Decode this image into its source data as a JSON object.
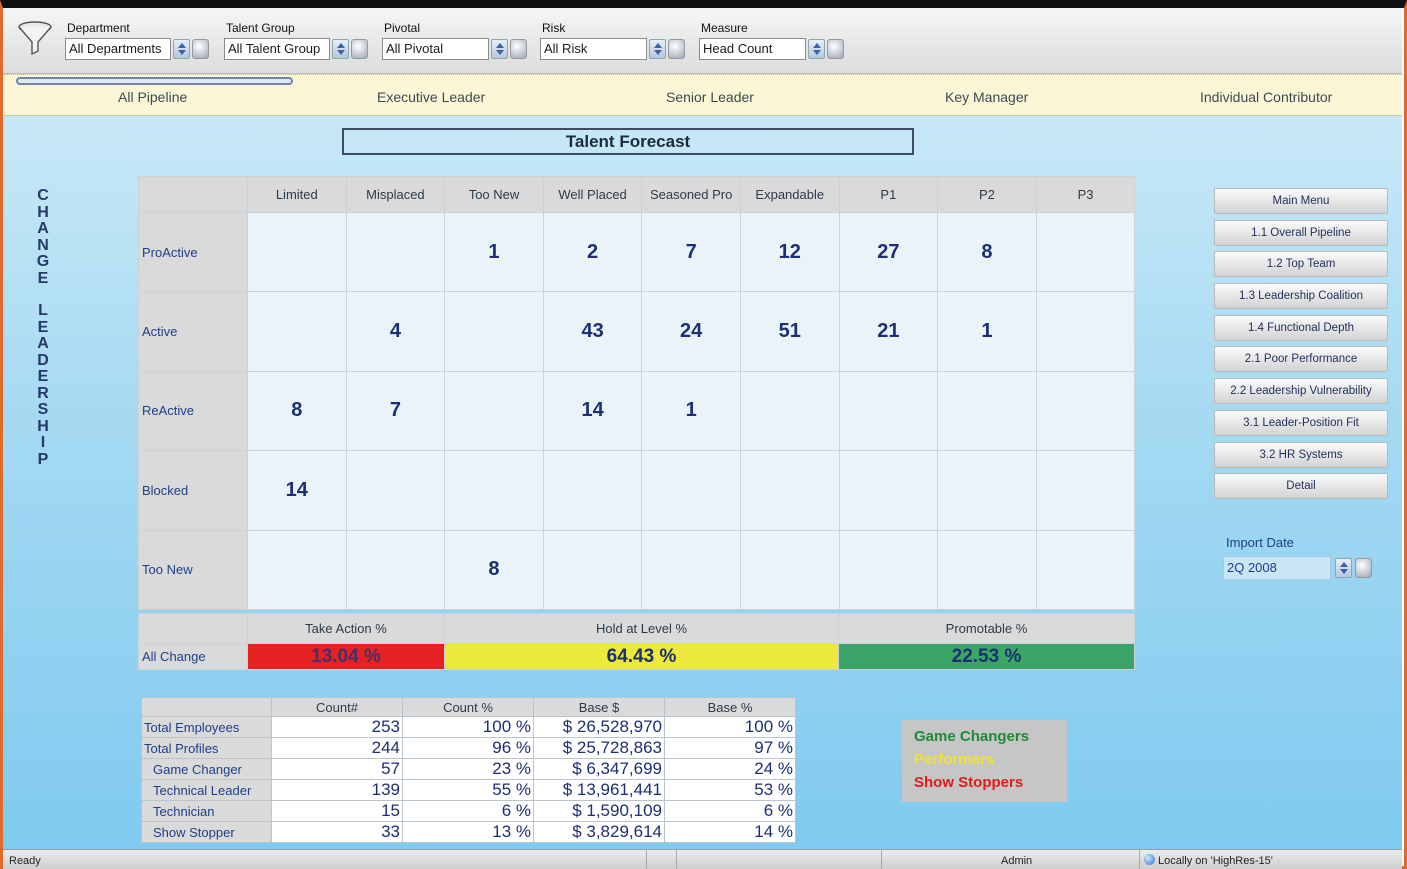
{
  "filters": [
    {
      "label": "Department",
      "value": "All Departments"
    },
    {
      "label": "Talent Group",
      "value": "All Talent Group"
    },
    {
      "label": "Pivotal",
      "value": "All Pivotal"
    },
    {
      "label": "Risk",
      "value": "All Risk"
    },
    {
      "label": "Measure",
      "value": "Head Count"
    }
  ],
  "tabs": [
    "All Pipeline",
    "Executive Leader",
    "Senior Leader",
    "Key Manager",
    "Individual Contributor"
  ],
  "title": "Talent Forecast",
  "side_label": "CHANGE LEADERSHIP",
  "matrix": {
    "columns": [
      "Limited",
      "Misplaced",
      "Too New",
      "Well Placed",
      "Seasoned Pro",
      "Expandable",
      "P1",
      "P2",
      "P3"
    ],
    "rows": [
      {
        "label": "ProActive",
        "cells": [
          "",
          "",
          "1",
          "2",
          "7",
          "12",
          "27",
          "8",
          ""
        ],
        "colors": [
          "",
          "",
          "y",
          "y",
          "y",
          "y",
          "g",
          "g",
          ""
        ]
      },
      {
        "label": "Active",
        "cells": [
          "",
          "4",
          "",
          "43",
          "24",
          "51",
          "21",
          "1",
          ""
        ],
        "colors": [
          "",
          "r",
          "",
          "y",
          "y",
          "y",
          "g",
          "g",
          ""
        ]
      },
      {
        "label": "ReActive",
        "cells": [
          "8",
          "7",
          "",
          "14",
          "1",
          "",
          "",
          "",
          ""
        ],
        "colors": [
          "r",
          "r",
          "",
          "y",
          "y",
          "",
          "",
          "",
          ""
        ]
      },
      {
        "label": "Blocked",
        "cells": [
          "14",
          "",
          "",
          "",
          "",
          "",
          "",
          "",
          ""
        ],
        "colors": [
          "r",
          "",
          "",
          "",
          "",
          "",
          "",
          "",
          ""
        ]
      },
      {
        "label": "Too New",
        "cells": [
          "",
          "",
          "8",
          "",
          "",
          "",
          "",
          "",
          ""
        ],
        "colors": [
          "",
          "",
          "y",
          "",
          "",
          "",
          "",
          "",
          ""
        ]
      }
    ]
  },
  "summary": {
    "headers": [
      "Take Action %",
      "Hold at Level %",
      "Promotable %"
    ],
    "row_label": "All Change",
    "values": [
      "13.04 %",
      "64.43 %",
      "22.53 %"
    ]
  },
  "stats": {
    "headers": [
      "Count#",
      "Count %",
      "Base $",
      "Base %"
    ],
    "rows": [
      {
        "label": "Total Employees",
        "indent": false,
        "values": [
          "253",
          "100 %",
          "$ 26,528,970",
          "100 %"
        ]
      },
      {
        "label": "Total Profiles",
        "indent": false,
        "values": [
          "244",
          "96 %",
          "$ 25,728,863",
          "97 %"
        ]
      },
      {
        "label": "Game Changer",
        "indent": true,
        "values": [
          "57",
          "23 %",
          "$ 6,347,699",
          "24 %"
        ]
      },
      {
        "label": "Technical Leader",
        "indent": true,
        "values": [
          "139",
          "55 %",
          "$ 13,961,441",
          "53 %"
        ]
      },
      {
        "label": "Technician",
        "indent": true,
        "values": [
          "15",
          "6 %",
          "$ 1,590,109",
          "6 %"
        ]
      },
      {
        "label": "Show Stopper",
        "indent": true,
        "values": [
          "33",
          "13 %",
          "$ 3,829,614",
          "14 %"
        ]
      }
    ]
  },
  "legend": [
    {
      "label": "Game Changers",
      "color": "#1f8a3a"
    },
    {
      "label": "Performers",
      "color": "#f2e22a"
    },
    {
      "label": "Show Stoppers",
      "color": "#e21b1b"
    }
  ],
  "nav": [
    "Main Menu",
    "1.1 Overall Pipeline",
    "1.2 Top Team",
    "1.3 Leadership Coalition",
    "1.4 Functional Depth",
    "2.1 Poor Performance",
    "2.2 Leadership Vulnerability",
    "3.1 Leader-Position Fit",
    "3.2 HR Systems",
    "Detail"
  ],
  "import": {
    "label": "Import Date",
    "value": "2Q 2008"
  },
  "status": {
    "left": "Ready",
    "user": "Admin",
    "connection": "Locally on 'HighRes-15'"
  },
  "colors": {
    "yellow": "#ece93c",
    "red": "#e52222",
    "green": "#3aa566",
    "accent": "#e0692e"
  }
}
